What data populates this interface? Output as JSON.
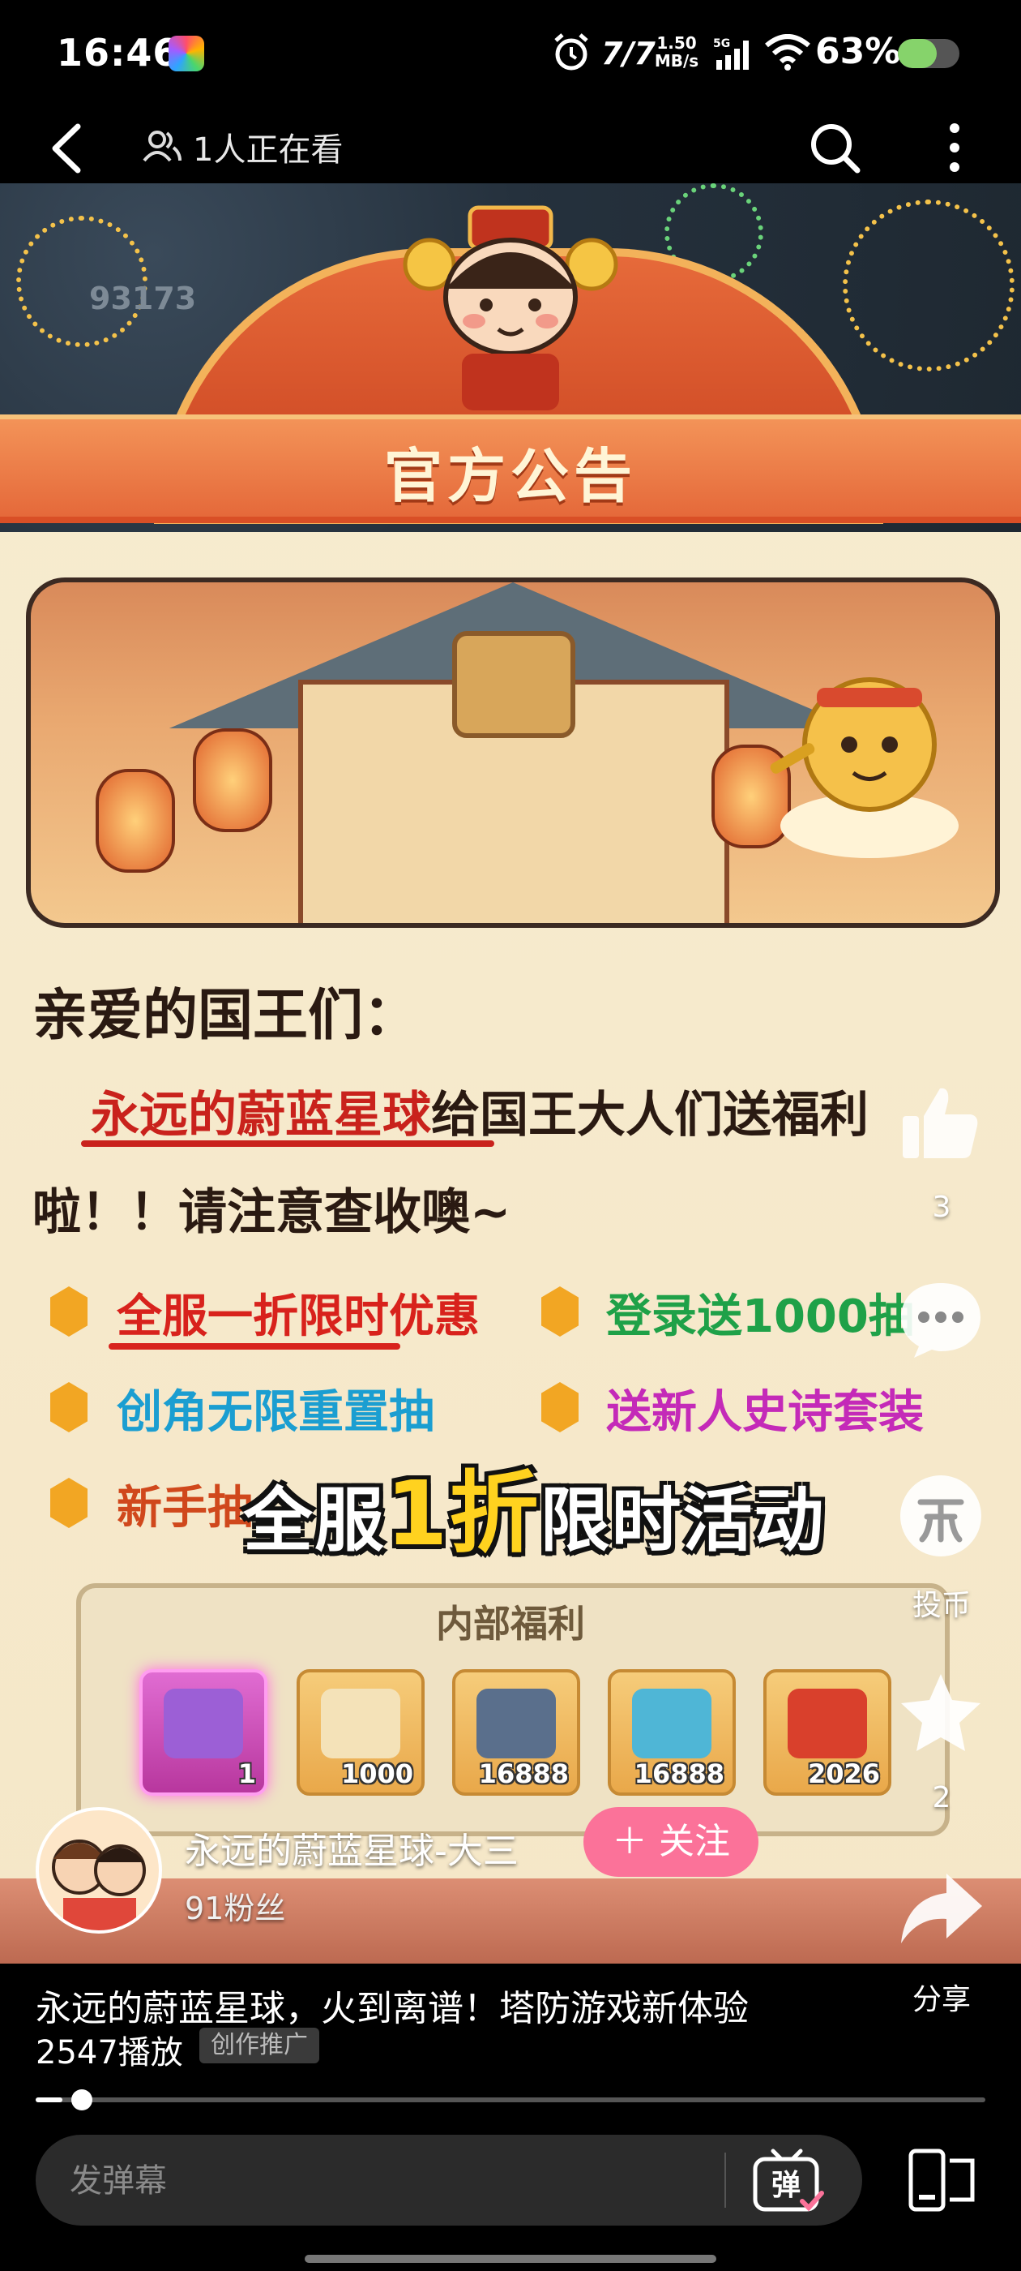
{
  "status_bar": {
    "time": "16:46",
    "net_speed_value": "1.50",
    "net_speed_unit": "MB/s",
    "network": "5G",
    "battery_percent_text": "63%",
    "battery_level": 0.63,
    "icons": [
      "app-icon",
      "alarm-icon",
      "nfc-icon",
      "signal-icon",
      "wifi-icon",
      "battery-icon"
    ]
  },
  "nav": {
    "viewers_text": "1人正在看",
    "icons": [
      "back-icon",
      "viewers-icon",
      "search-icon",
      "more-icon"
    ]
  },
  "video": {
    "coin_counter": "93173",
    "banner_title": "官方公告",
    "greeting": "亲爱的国王们：",
    "line1_highlight": "永远的蔚蓝星球",
    "line1_rest": "给国王大人们送福利",
    "line2": "啦！！请注意查收噢~",
    "bullets": [
      {
        "text": "全服一折限时优惠",
        "color": "#d8221c"
      },
      {
        "text": "登录送1000抽",
        "color": "#1fa148"
      },
      {
        "text": "创角无限重置抽",
        "color": "#1b9ed1"
      },
      {
        "text": "送新人史诗套装",
        "color": "#c42ab8"
      },
      {
        "text": "新手抽",
        "color": "#d0481c"
      }
    ],
    "overlay_caption": {
      "before": "全服",
      "highlight": "1折",
      "after": "限时活动"
    },
    "perk_title": "内部福利",
    "perks": [
      {
        "count": "1"
      },
      {
        "count": "1000"
      },
      {
        "count": "16888"
      },
      {
        "count": "16888"
      },
      {
        "count": "2026"
      }
    ]
  },
  "creator": {
    "name": "永远的蔚蓝星球-大三",
    "follow_label": "＋ 关注",
    "fans": "91粉丝"
  },
  "actions": {
    "like_count": "3",
    "coin_label": "投币",
    "favorite_count": "2",
    "share_label": "分享"
  },
  "description": {
    "title": "永远的蔚蓝星球，火到离谱！塔防游戏新体验",
    "plays": "2547播放",
    "promo_tag": "创作推广"
  },
  "player": {
    "progress": 0.028
  },
  "danmaku": {
    "placeholder": "发弹幕",
    "toggle_label": "弹"
  },
  "colors": {
    "accent_pink": "#fb7299",
    "background": "#000000"
  }
}
